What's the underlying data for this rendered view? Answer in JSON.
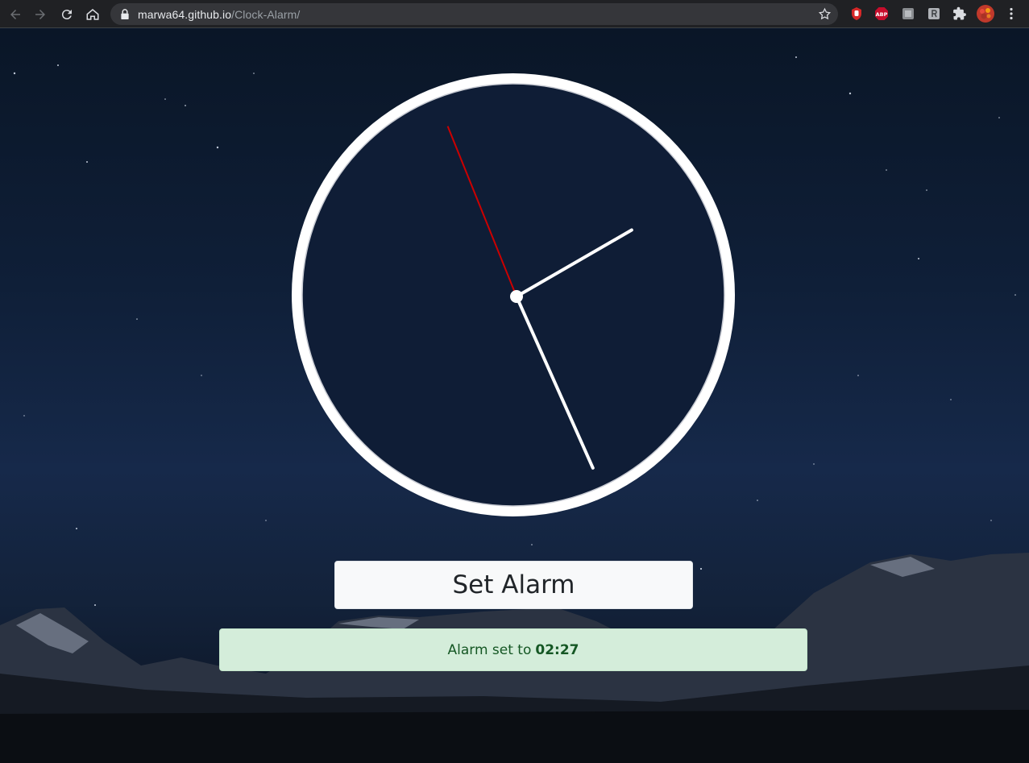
{
  "browser": {
    "url_host": "marwa64.github.io",
    "url_path": "/Clock-Alarm/",
    "icons": [
      "back-icon",
      "forward-icon",
      "reload-icon",
      "home-icon",
      "lock-icon",
      "bookmark-star-icon",
      "stop-hand-icon",
      "adblock-plus-icon",
      "extension-icon",
      "extension-r-icon",
      "puzzle-icon",
      "avatar-icon",
      "menu-kebab-icon"
    ],
    "adblock_label": "ABP"
  },
  "clock": {
    "hour_hand_deg": 60,
    "minute_hand_deg": 156,
    "second_hand_deg": 338,
    "second_hand_color": "#cc0000",
    "hand_color": "#ffffff",
    "rim_color": "#ffffff"
  },
  "alarm": {
    "button_label": "Set Alarm",
    "message_prefix": "Alarm set to",
    "time": "02:27"
  },
  "colors": {
    "alert_bg": "#d4edda",
    "alert_text": "#155724",
    "button_bg": "#f8f9fa"
  }
}
